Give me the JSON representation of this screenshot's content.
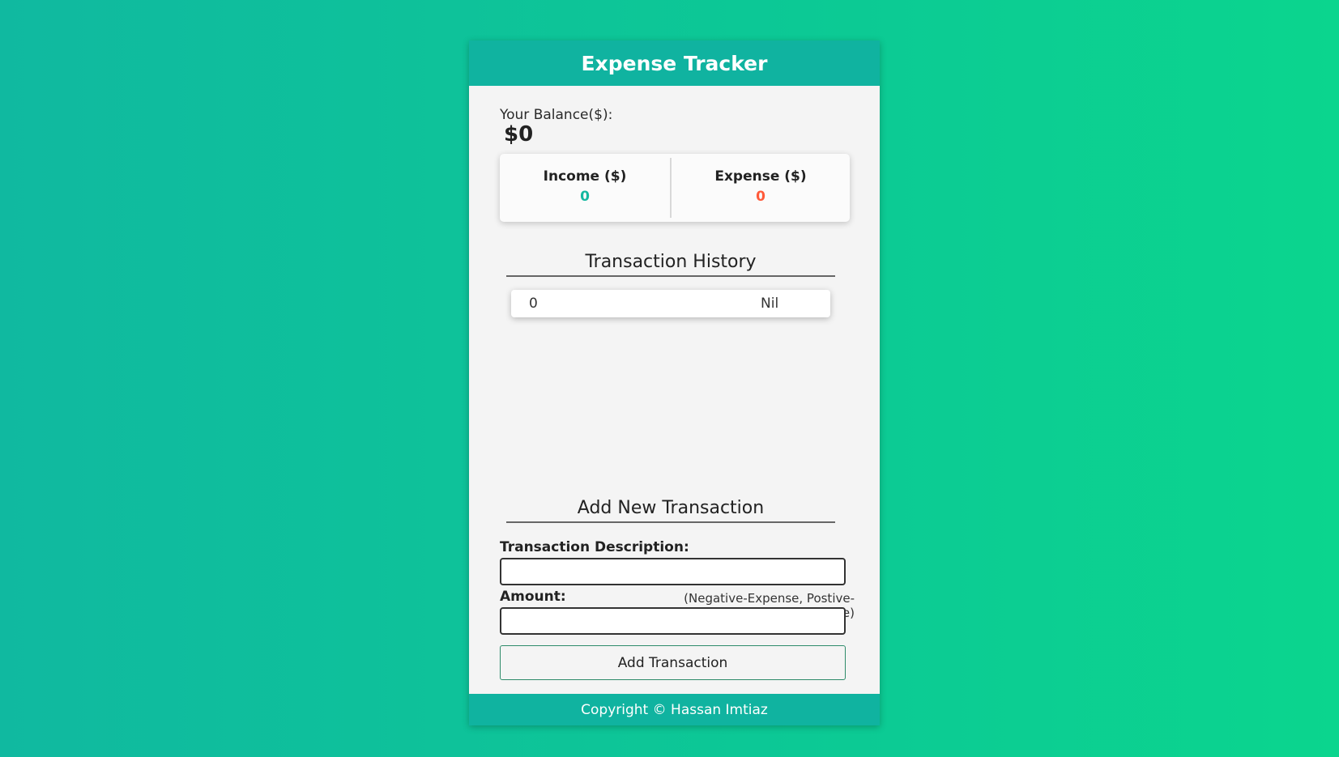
{
  "header": {
    "title": "Expense Tracker"
  },
  "balance": {
    "label": "Your Balance($):",
    "value": "$0"
  },
  "summary": {
    "income_label": "Income ($)",
    "income_value": "0",
    "expense_label": "Expense ($)",
    "expense_value": "0"
  },
  "history": {
    "title": "Transaction History",
    "items": [
      {
        "amount": "0",
        "description": "Nil"
      }
    ]
  },
  "add_form": {
    "title": "Add New Transaction",
    "description_label": "Transaction Description:",
    "description_value": "",
    "amount_label": "Amount:",
    "amount_hint": "(Negative-Expense, Postive-Expense)",
    "amount_value": "",
    "submit_label": "Add Transaction"
  },
  "footer": {
    "text": "Copyright © Hassan Imtiaz"
  },
  "colors": {
    "brand": "#10b3a0",
    "income": "#14b8a0",
    "expense": "#ff5a3a"
  }
}
